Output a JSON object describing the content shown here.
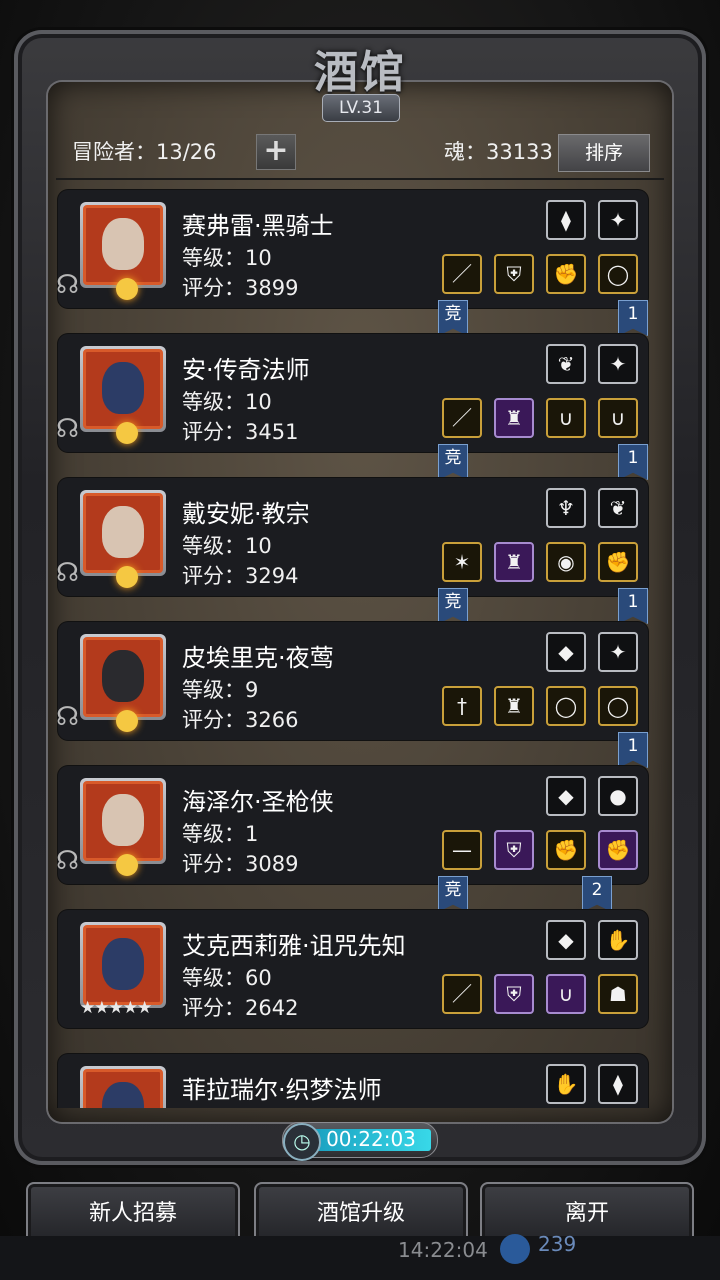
{
  "window": {
    "title": "酒馆",
    "level": "LV.31"
  },
  "header": {
    "adventurers_label": "冒险者：13/26",
    "add_icon": "plus-icon",
    "soul_label": "魂：33133",
    "sort_label": "排序"
  },
  "heroes": [
    {
      "name": "赛弗雷·黑骑士",
      "level": "等级：10",
      "score": "评分：3899",
      "portrait": "portrait-silver-hair",
      "marker": "crescent",
      "slots_top": [
        {
          "icon": "boot-icon",
          "tier": "gray"
        },
        {
          "icon": "crystal-icon",
          "tier": "gray"
        }
      ],
      "slots_bottom": [
        {
          "icon": "spear-icon",
          "tier": "gold"
        },
        {
          "icon": "armor-icon",
          "tier": "gold"
        },
        {
          "icon": "gauntlet-icon",
          "tier": "gold"
        },
        {
          "icon": "ring-icon",
          "tier": "gold"
        }
      ],
      "badges": [
        "竞",
        "1"
      ]
    },
    {
      "name": "安·传奇法师",
      "level": "等级：10",
      "score": "评分：3451",
      "portrait": "portrait-hooded",
      "marker": "crescent",
      "slots_top": [
        {
          "icon": "feather-icon",
          "tier": "gray"
        },
        {
          "icon": "crystal-icon",
          "tier": "gray"
        }
      ],
      "slots_bottom": [
        {
          "icon": "staff-icon",
          "tier": "gold"
        },
        {
          "icon": "robe-icon",
          "tier": "purple"
        },
        {
          "icon": "necklace-icon",
          "tier": "gold"
        },
        {
          "icon": "necklace-icon",
          "tier": "gold"
        }
      ],
      "badges": [
        "竞",
        "1"
      ]
    },
    {
      "name": "戴安妮·教宗",
      "level": "等级：10",
      "score": "评分：3294",
      "portrait": "portrait-bonnet",
      "marker": "crescent",
      "slots_top": [
        {
          "icon": "amulet-icon",
          "tier": "gray"
        },
        {
          "icon": "feather-icon",
          "tier": "gray"
        }
      ],
      "slots_bottom": [
        {
          "icon": "mace-icon",
          "tier": "gold"
        },
        {
          "icon": "cloak-icon",
          "tier": "purple"
        },
        {
          "icon": "orb-icon",
          "tier": "gold"
        },
        {
          "icon": "gauntlet-icon",
          "tier": "gold"
        }
      ],
      "badges": [
        "竞",
        "1"
      ]
    },
    {
      "name": "皮埃里克·夜莺",
      "level": "等级：9",
      "score": "评分：3266",
      "portrait": "portrait-helmet",
      "marker": "crescent",
      "slots_top": [
        {
          "icon": "gem-icon",
          "tier": "gray"
        },
        {
          "icon": "crystal-icon",
          "tier": "gray"
        }
      ],
      "slots_bottom": [
        {
          "icon": "dagger-icon",
          "tier": "gold"
        },
        {
          "icon": "cloak-icon",
          "tier": "gold"
        },
        {
          "icon": "ring-icon",
          "tier": "gold"
        },
        {
          "icon": "ring-icon",
          "tier": "gold"
        }
      ],
      "badges": [
        "1"
      ]
    },
    {
      "name": "海泽尔·圣枪侠",
      "level": "等级：1",
      "score": "评分：3089",
      "portrait": "portrait-headband",
      "marker": "crescent",
      "slots_top": [
        {
          "icon": "gem-icon",
          "tier": "gray"
        },
        {
          "icon": "ruby-icon",
          "tier": "gray"
        }
      ],
      "slots_bottom": [
        {
          "icon": "gun-icon",
          "tier": "gold"
        },
        {
          "icon": "armor-icon",
          "tier": "purple"
        },
        {
          "icon": "gauntlet-icon",
          "tier": "gold"
        },
        {
          "icon": "gauntlet-icon",
          "tier": "purple"
        }
      ],
      "badges": [
        "竞",
        "2"
      ]
    },
    {
      "name": "艾克西莉雅·诅咒先知",
      "level": "等级：60",
      "score": "评分：2642",
      "portrait": "portrait-hooded",
      "marker": "stars",
      "stars": "★★★★★",
      "slots_top": [
        {
          "icon": "gem-icon",
          "tier": "gray"
        },
        {
          "icon": "glove-icon",
          "tier": "gray"
        }
      ],
      "slots_bottom": [
        {
          "icon": "staff-icon",
          "tier": "gold"
        },
        {
          "icon": "armor-icon",
          "tier": "purple"
        },
        {
          "icon": "necklace-icon",
          "tier": "purple"
        },
        {
          "icon": "mask-icon",
          "tier": "gold"
        }
      ],
      "badges": []
    },
    {
      "name": "菲拉瑞尔·织梦法师",
      "level": "",
      "score": "",
      "portrait": "portrait-hooded",
      "marker": "none",
      "slots_top": [
        {
          "icon": "glove-icon",
          "tier": "gray"
        },
        {
          "icon": "boot-icon",
          "tier": "gray"
        }
      ],
      "slots_bottom": [],
      "badges": []
    }
  ],
  "timer": {
    "value": "00:22:03",
    "icon": "clock-icon"
  },
  "buttons": {
    "recruit": "新人招募",
    "upgrade": "酒馆升级",
    "leave": "离开"
  },
  "statusbar": {
    "clock": "14:22:04",
    "soul_value": "239"
  },
  "colors": {
    "gold_border": "#c9a03a",
    "purple_border": "#a78bd0",
    "portrait_red": "#b33a1c",
    "timer_cyan": "#38d8e8"
  }
}
